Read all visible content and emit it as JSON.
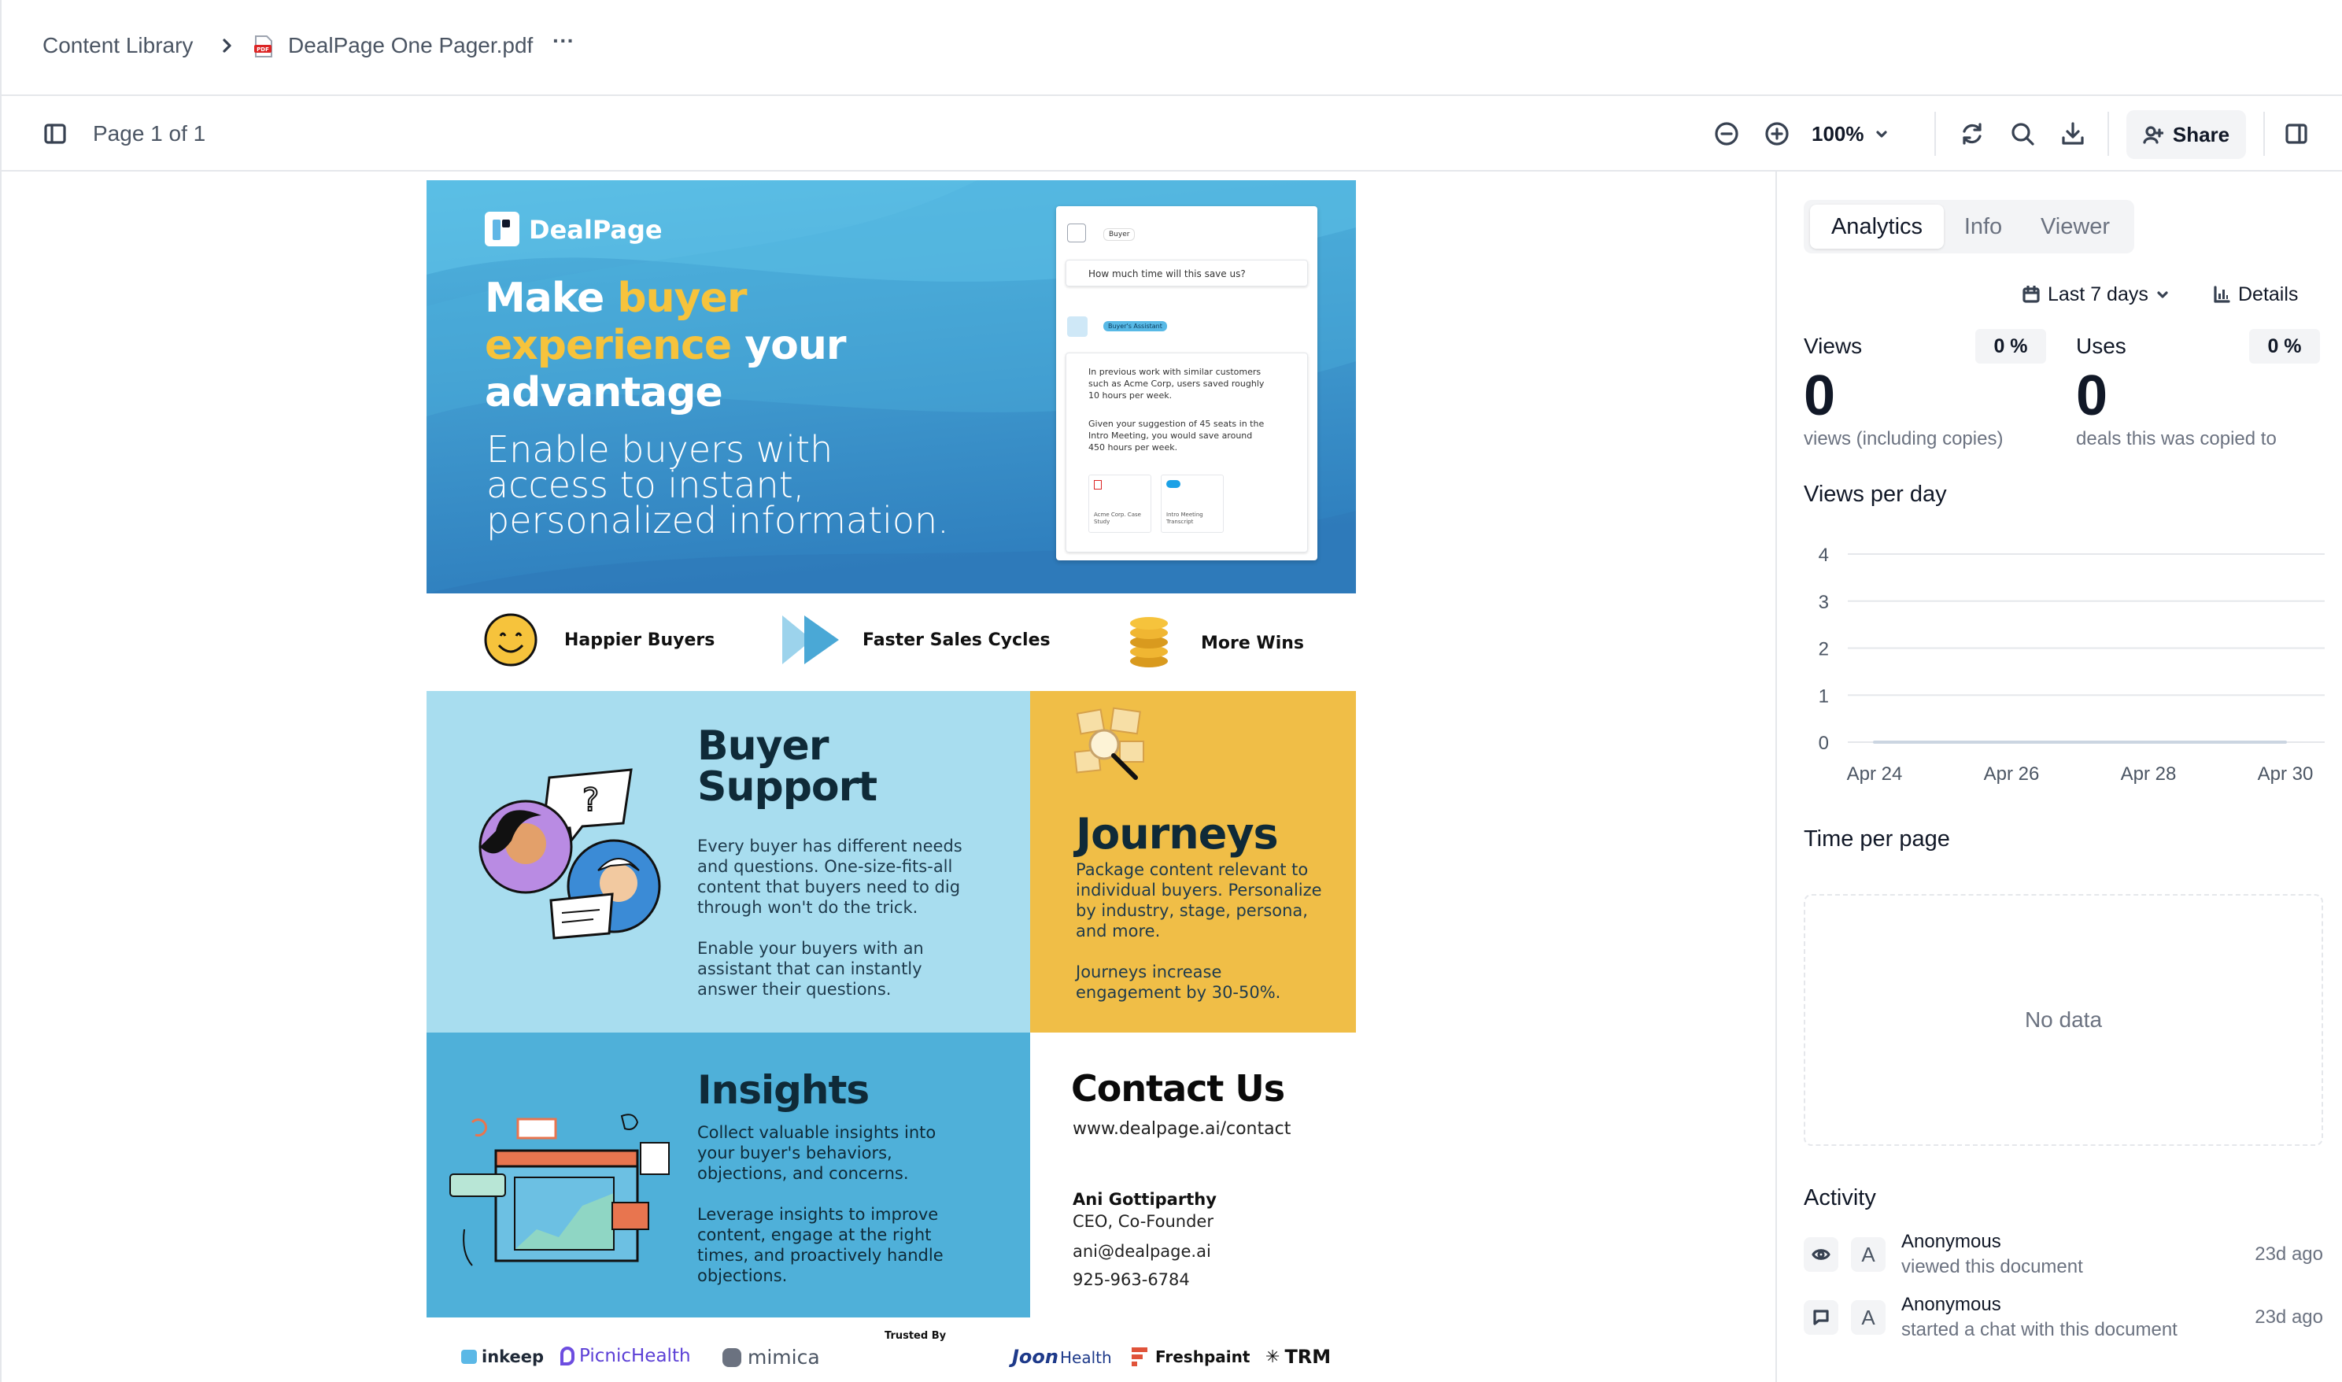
{
  "breadcrumb": {
    "root": "Content Library",
    "file_name": "DealPage One Pager.pdf",
    "more_label": "···"
  },
  "toolbar": {
    "page_indicator": "Page 1 of 1",
    "zoom": "100%",
    "share_label": "Share"
  },
  "panel": {
    "tabs": [
      "Analytics",
      "Info",
      "Viewer"
    ],
    "active_tab": "Analytics",
    "date_range": "Last 7 days",
    "details_label": "Details",
    "views": {
      "label": "Views",
      "value": "0",
      "pct": "0 %",
      "caption": "views (including copies)"
    },
    "uses": {
      "label": "Uses",
      "value": "0",
      "pct": "0 %",
      "caption": "deals this was copied to"
    },
    "views_per_day_title": "Views per day",
    "time_per_page_title": "Time per page",
    "no_data": "No data",
    "activity_title": "Activity",
    "activity": [
      {
        "icon": "eye-icon",
        "avatar": "A",
        "name": "Anonymous",
        "action": "viewed this document",
        "time": "23d ago"
      },
      {
        "icon": "chat-icon",
        "avatar": "A",
        "name": "Anonymous",
        "action": "started a chat with this document",
        "time": "23d ago"
      }
    ]
  },
  "chart_data": {
    "type": "line",
    "title": "Views per day",
    "x": [
      "Apr 24",
      "Apr 25",
      "Apr 26",
      "Apr 27",
      "Apr 28",
      "Apr 29",
      "Apr 30"
    ],
    "x_tick_labels": [
      "Apr 24",
      "Apr 26",
      "Apr 28",
      "Apr 30"
    ],
    "series": [
      {
        "values": [
          0,
          0,
          0,
          0,
          0,
          0,
          0
        ]
      }
    ],
    "ylim": [
      0,
      4
    ],
    "y_ticks": [
      0,
      1,
      2,
      3,
      4
    ],
    "grid": true
  },
  "document": {
    "brand": "DealPage",
    "headline_white_1": "Make ",
    "headline_yellow_1": "buyer",
    "headline_yellow_2": "experience",
    "headline_white_2": " your",
    "headline_white_3": "advantage",
    "subheadline": [
      "Enable buyers with",
      "access to instant,",
      "personalized information."
    ],
    "mock": {
      "buyer_tag": "Buyer",
      "question": "How much time will this save us?",
      "assistant_tag": "Buyer's Assistant",
      "answer_1": [
        "In previous work with similar customers",
        "such as Acme Corp, users saved roughly",
        "10 hours per week."
      ],
      "answer_2": [
        "Given your suggestion of 45 seats in the",
        "Intro Meeting, you would save around",
        "450 hours per week."
      ],
      "sources": [
        "Acme Corp. Case Study",
        "Intro Meeting Transcript"
      ]
    },
    "benefits": [
      "Happier Buyers",
      "Faster Sales Cycles",
      "More Wins"
    ],
    "support": {
      "title_1": "Buyer",
      "title_2": "Support",
      "p1": [
        "Every buyer has different needs",
        "and questions. One-size-fits-all",
        "content that buyers need to dig",
        "through won't do the trick."
      ],
      "p2": [
        "Enable your buyers with an",
        "assistant that can instantly",
        "answer their questions."
      ]
    },
    "journeys": {
      "title": "Journeys",
      "p1": [
        "Package content relevant to",
        "individual buyers. Personalize",
        "by industry, stage, persona,",
        "and more."
      ],
      "p2": [
        "Journeys increase",
        "engagement by 30-50%."
      ]
    },
    "insights": {
      "title": "Insights",
      "p1": [
        "Collect valuable insights into",
        "your buyer's behaviors,",
        "objections, and concerns."
      ],
      "p2": [
        "Leverage insights to improve",
        "content, engage at the right",
        "times, and proactively handle",
        "objections."
      ]
    },
    "contact": {
      "title": "Contact Us",
      "url": "www.dealpage.ai/contact",
      "name": "Ani Gottiparthy",
      "role": "CEO, Co-Founder",
      "email": "ani@dealpage.ai",
      "phone": "925-963-6784"
    },
    "trusted_by": "Trusted By",
    "logos": [
      "inkeep",
      "PicnicHealth",
      "mimica",
      "Joon",
      "Health",
      "Freshpaint",
      "TRM"
    ]
  }
}
